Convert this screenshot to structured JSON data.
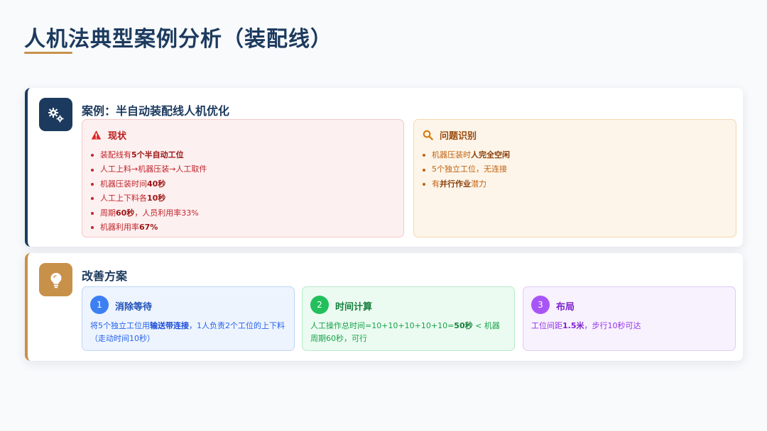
{
  "page": {
    "title": "人机法典型案例分析（装配线）"
  },
  "case": {
    "title": "案例：半自动装配线人机优化",
    "icon": "gears-icon",
    "status": {
      "heading": "现状",
      "icon": "warning-icon",
      "items": [
        {
          "pre": "装配线有",
          "bold": "5个半自动工位",
          "post": ""
        },
        {
          "pre": "人工上料→机器压装→人工取件",
          "bold": "",
          "post": ""
        },
        {
          "pre": "机器压装时间",
          "bold": "40秒",
          "post": ""
        },
        {
          "pre": "人工上下料各",
          "bold": "10秒",
          "post": ""
        },
        {
          "pre": "周期",
          "bold": "60秒",
          "post": "，人员利用率33%"
        },
        {
          "pre": "机器利用率",
          "bold": "67%",
          "post": ""
        }
      ]
    },
    "issues": {
      "heading": "问题识别",
      "icon": "search-icon",
      "items": [
        {
          "pre": "机器压装时",
          "bold": "人完全空闲",
          "post": ""
        },
        {
          "pre": "5个独立工位，无连接",
          "bold": "",
          "post": ""
        },
        {
          "pre": "有",
          "bold": "并行作业",
          "post": "潜力"
        }
      ]
    }
  },
  "improve": {
    "title": "改善方案",
    "icon": "lightbulb-icon",
    "steps": [
      {
        "num": "1",
        "title": "消除等待",
        "pre": "将5个独立工位用",
        "bold": "输送带连接",
        "post": "，1人负责2个工位的上下料（走动时间10秒）"
      },
      {
        "num": "2",
        "title": "时间计算",
        "pre": "人工操作总时间=10+10+10+10+10=",
        "bold": "50秒",
        "post": " < 机器周期60秒，可行"
      },
      {
        "num": "3",
        "title": "布局",
        "pre": "工位间距",
        "bold": "1.5米",
        "post": "，步行10秒可达"
      }
    ]
  },
  "colors": {
    "navy": "#1c3a5e",
    "accent": "#c8914a",
    "status_red": "#c0262d",
    "issue_orange": "#c2620f",
    "step_blue": "#3b7ff2",
    "step_green": "#22c05c",
    "step_purple": "#a855f7"
  }
}
